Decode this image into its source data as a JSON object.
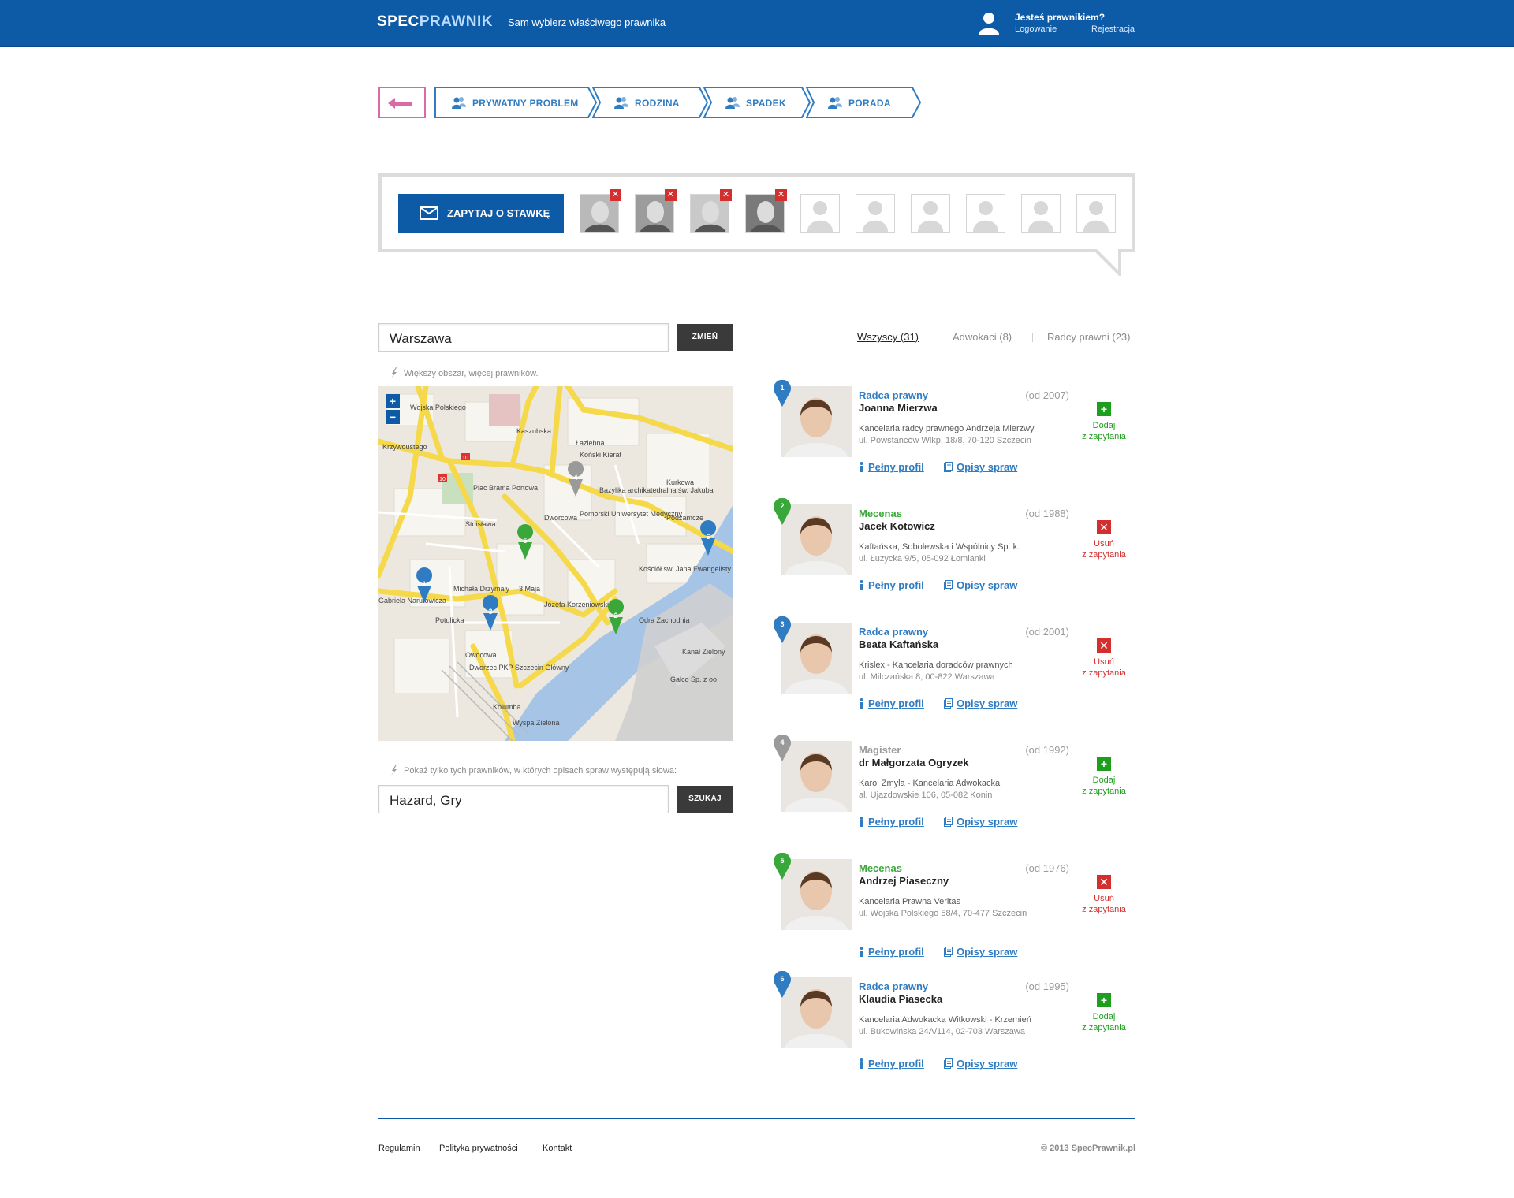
{
  "header": {
    "logo_part1": "SPEC",
    "logo_part2": "PRAWNIK",
    "tagline_bold": "Sam wybierz",
    "tagline_rest": " właściwego prawnika",
    "lawyer_question": "Jesteś prawnikiem?",
    "login": "Logowanie",
    "register": "Rejestracja"
  },
  "steps": [
    "PRYWATNY PROBLEM",
    "RODZINA",
    "SPADEK",
    "PORADA"
  ],
  "ask": {
    "button_label": "ZAPYTAJ O STAWKĘ",
    "selected_count": 4,
    "total_slots": 10
  },
  "search": {
    "location_value": "Warszawa",
    "change_button": "ZMIEŃ",
    "hint_area": "Większy obszar, więcej prawników.",
    "hint_keywords": "Pokaż tylko tych prawników, w których opisach spraw występują słowa:",
    "keywords_value": "Hazard, Gry",
    "search_button": "SZUKAJ"
  },
  "map": {
    "zoom_in": "+",
    "zoom_out": "−",
    "labels": [
      "Plac Brama Portowa",
      "Bazylika archikatedralna św. Jakuba",
      "Pomorski Uniwersytet Medyczny",
      "Podzamcze",
      "Kościół św. Jana Ewangelisty",
      "Odra Zachodnia",
      "Kanał Zielony",
      "Dworzec PKP Szczecin Główny",
      "Wyspa Zielona",
      "Galco Sp. z oo",
      "Krzywoustego",
      "Stoisława",
      "3 Maja",
      "Owocowa",
      "Kaszubska",
      "Dworcowa",
      "Łaziebna",
      "Koński Kierat",
      "Kurkowa",
      "Michała Drzymały",
      "Gabriela Narutowicza",
      "Wojska Polskiego",
      "Potulicka",
      "Kolumba",
      "Józefa Korzeniowskiego"
    ],
    "road_markers": [
      "10",
      "10"
    ]
  },
  "tabs": [
    {
      "label": "Wszyscy (31)",
      "active": true
    },
    {
      "label": "Adwokaci (8)",
      "active": false
    },
    {
      "label": "Radcy prawni (23)",
      "active": false
    }
  ],
  "actions": {
    "profile": "Pełny profil",
    "cases": "Opisy spraw",
    "add": "Dodaj",
    "remove": "Usuń",
    "from_requests": "z zapytania"
  },
  "lawyers": [
    {
      "num": "1",
      "role": "Radca prawny",
      "since": "(od 2007)",
      "name": "Joanna Mierzwa",
      "firm": "Kancelaria radcy prawnego Andrzeja Mierzwy",
      "address": "ul. Powstańców Wlkp. 18/8, 70-120 Szczecin",
      "color": "#2f7cc3",
      "selected": false
    },
    {
      "num": "2",
      "role": "Mecenas",
      "since": "(od 1988)",
      "name": "Jacek Kotowicz",
      "firm": "Kaftańska, Sobolewska i Wspólnicy Sp. k.",
      "address": "ul. Łużycka 9/5, 05-092 Łomianki",
      "color": "#3aa73a",
      "selected": true
    },
    {
      "num": "3",
      "role": "Radca prawny",
      "since": "(od 2001)",
      "name": "Beata Kaftańska",
      "firm": "Krislex - Kancelaria doradców prawnych",
      "address": "ul. Milczańska 8, 00-822 Warszawa",
      "color": "#2f7cc3",
      "selected": true
    },
    {
      "num": "4",
      "role": "Magister",
      "since": "(od 1992)",
      "name": "dr Małgorzata Ogryzek",
      "firm": "Karol Zmyla - Kancelaria Adwokacka",
      "address": "al. Ujazdowskie 106, 05-082 Konin",
      "color": "#9a9a9a",
      "selected": false
    },
    {
      "num": "5",
      "role": "Mecenas",
      "since": "(od 1976)",
      "name": "Andrzej Piaseczny",
      "firm": "Kancelaria Prawna Veritas",
      "address": "ul. Wojska Polskiego 58/4, 70-477 Szczecin",
      "color": "#3aa73a",
      "selected": true
    },
    {
      "num": "6",
      "role": "Radca prawny",
      "since": "(od 1995)",
      "name": "Klaudia Piasecka",
      "firm": "Kancelaria Adwokacka Witkowski - Krzemień",
      "address": "ul. Bukowińska 24A/114, 02-703 Warszawa",
      "color": "#2f7cc3",
      "selected": false
    }
  ],
  "footer": {
    "links": [
      "Regulamin",
      "Polityka prywatności",
      "Kontakt"
    ],
    "copyright": "© 2013 SpecPrawnik.pl"
  },
  "colors": {
    "brand": "#0d5aa7",
    "link": "#2f7cc3",
    "add_green": "#1e9e1e",
    "remove_red": "#d32f2f",
    "back_pink": "#d86aa7"
  }
}
